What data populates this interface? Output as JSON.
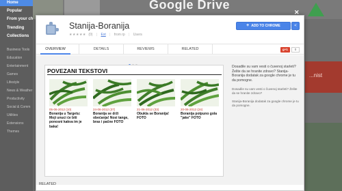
{
  "store": {
    "nav": [
      {
        "label": "Home",
        "bold": true
      },
      {
        "label": "Popular",
        "bold": true
      },
      {
        "label": "From your ch",
        "bold": true
      },
      {
        "label": "Trending",
        "bold": true
      },
      {
        "label": "Collections",
        "bold": true
      }
    ],
    "categories": [
      "Business Tools",
      "Education",
      "Entertainment",
      "Games",
      "Lifestyle",
      "News & Weather",
      "Productivity",
      "Social & Comm",
      "Utilities",
      "Extensions",
      "Themes"
    ],
    "banner_title": "Google Drive",
    "right_tile_label": "...nist"
  },
  "app": {
    "title": "Stanija-Boranija",
    "stars": "★★★★★",
    "rating_count": "(0)",
    "category_link": "Ext",
    "offered_by": "from rp",
    "users": "Users",
    "add_button": "ADD TO CHROME",
    "share_icon": "share-icon",
    "close_icon": "close-icon"
  },
  "tabs": [
    {
      "label": "OVERVIEW",
      "active": true
    },
    {
      "label": "DETAILS",
      "active": false
    },
    {
      "label": "REVIEWS",
      "active": false
    },
    {
      "label": "RELATED",
      "active": false
    }
  ],
  "gplus": {
    "label": "g+1",
    "count": "0"
  },
  "screenshot": {
    "heading": "POVEZANI TEKSTOVI",
    "cards": [
      {
        "date": "05-06-2012 (10)",
        "title": "Boranija u Targetu: Moji unuci će biti ponosni kakva im je baka!"
      },
      {
        "date": "24-06-2012 (37)",
        "title": "Boranija se drži obećanja! Nosi tange, bras i pačne FOTO"
      },
      {
        "date": "21-06-2012 (33)",
        "title": "Obukla se Boranija! FOTO"
      },
      {
        "date": "20-06-2012 (24)",
        "title": "Boranija potpuno gola \"jake\" FOTO"
      }
    ]
  },
  "description": {
    "main": "Dosadile su vam vesti o čuvenoj starleti? Želite da se hranite zdravo? Stanija-Boranija dodatak za google chrome je tu da pomogne.",
    "sub1": "Dosadile su vam vesti o čuvenoj starleti? Želite da se hranite zdravo?",
    "sub2": "Stanija-Boranija dodatak za google chrome je tu da pomogne."
  },
  "related_label": "RELATED",
  "colors": {
    "accent": "#4a84e8",
    "gplus": "#d9442f",
    "date_red": "#c0392b"
  }
}
